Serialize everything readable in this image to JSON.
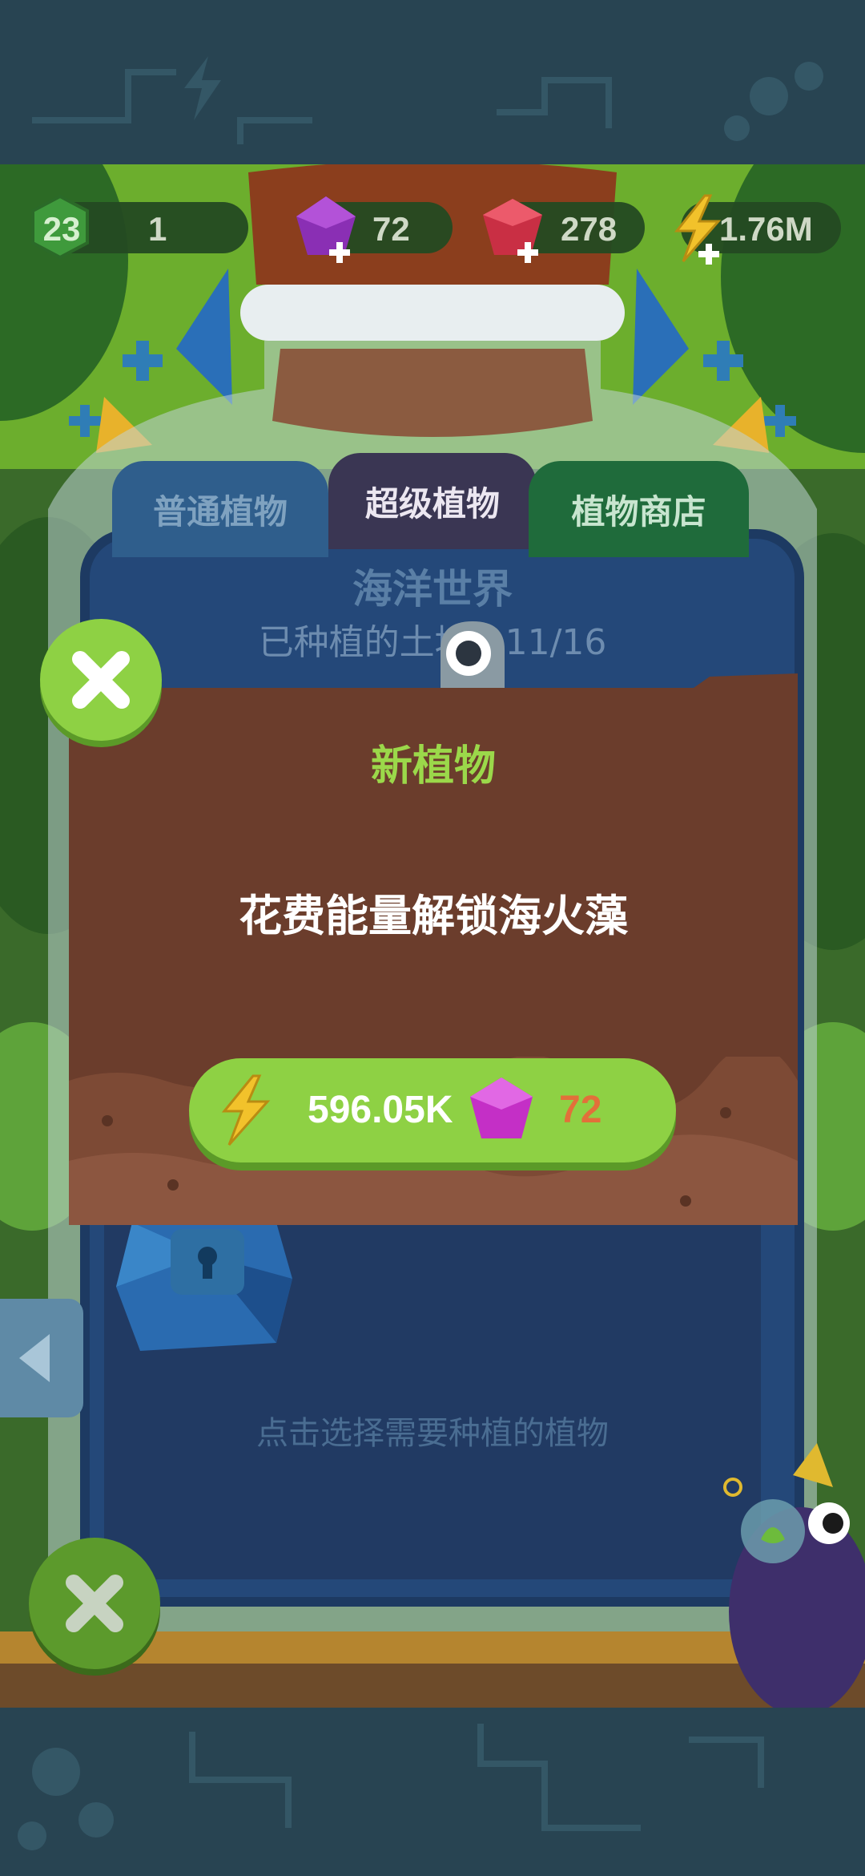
{
  "status_bar": {
    "level": "23",
    "level_progress": "1",
    "gems_purple": "72",
    "gems_red": "278",
    "energy": "1.76M"
  },
  "tabs": {
    "normal": "普通植物",
    "super": "超级植物",
    "shop": "植物商店"
  },
  "world": {
    "name": "海洋世界",
    "planted_label": "已种植的土地：",
    "planted_value": "11/16"
  },
  "modal": {
    "title": "新植物",
    "message": "花费能量解锁海火藻",
    "energy_cost": "596.05K",
    "gem_cost": "72"
  },
  "panel_hint": "点击选择需要种植的植物",
  "colors": {
    "accent_green": "#8ed144",
    "title_green": "#9bd84a",
    "modal_brown": "#6b3d2c",
    "gem_cost_orange": "#e2703a",
    "panel_blue": "#244879"
  },
  "icons": [
    "level-badge-icon",
    "purple-gem-icon",
    "red-gem-icon",
    "lightning-icon",
    "close-icon",
    "back-arrow-icon",
    "lock-icon"
  ]
}
